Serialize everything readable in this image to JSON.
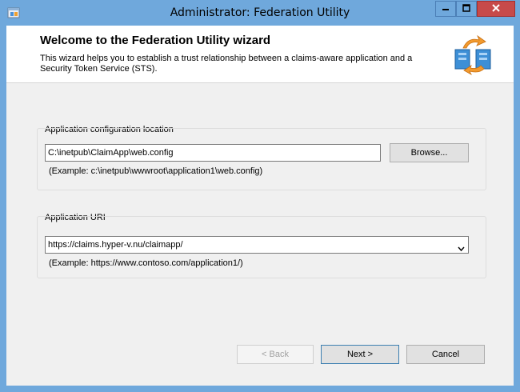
{
  "window": {
    "title": "Administrator: Federation Utility"
  },
  "header": {
    "title": "Welcome to the Federation Utility wizard",
    "description": "This wizard helps you to establish a trust relationship between a claims-aware application and a Security Token Service (STS)."
  },
  "app_config": {
    "group_label": "Application configuration location",
    "value": "C:\\inetpub\\ClaimApp\\web.config",
    "browse_label": "Browse...",
    "example": "(Example: c:\\inetpub\\wwwroot\\application1\\web.config)"
  },
  "app_uri": {
    "group_label": "Application URI",
    "value": "https://claims.hyper-v.nu/claimapp/",
    "example": "(Example: https://www.contoso.com/application1/)"
  },
  "footer": {
    "back_label": "< Back",
    "next_label": "Next >",
    "cancel_label": "Cancel"
  },
  "colors": {
    "title_bar": "#6fa8dc",
    "close_button": "#c74a4a"
  },
  "icons": {
    "app": "federation-app-icon",
    "header": "federation-sync-icon",
    "minimize": "minimize-icon",
    "maximize": "maximize-icon",
    "close": "close-icon",
    "dropdown": "chevron-down-icon"
  }
}
